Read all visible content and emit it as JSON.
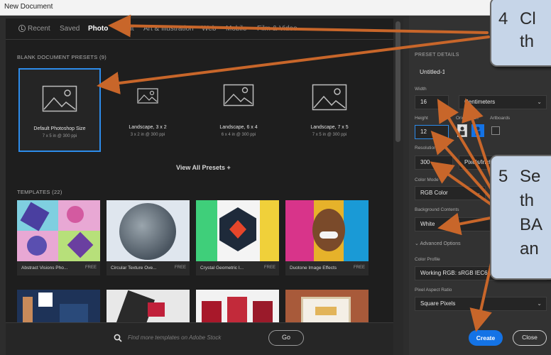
{
  "window": {
    "title": "New Document"
  },
  "tabs": [
    {
      "label": "Recent",
      "icon": "clock-icon"
    },
    {
      "label": "Saved"
    },
    {
      "label": "Photo",
      "active": true
    },
    {
      "label": "Print"
    },
    {
      "label": "Art & Illustration"
    },
    {
      "label": "Web"
    },
    {
      "label": "Mobile"
    },
    {
      "label": "Film & Video"
    }
  ],
  "presets": {
    "heading": "BLANK DOCUMENT PRESETS",
    "count": "(9)",
    "items": [
      {
        "name": "Default Photoshop Size",
        "desc": "7 x 5 in @ 300 ppi",
        "selected": true
      },
      {
        "name": "Landscape, 3 x 2",
        "desc": "3 x 2 in @ 300 ppi"
      },
      {
        "name": "Landscape, 6 x 4",
        "desc": "6 x 4 in @ 300 ppi"
      },
      {
        "name": "Landscape, 7 x 5",
        "desc": "7 x 5 in @ 300 ppi"
      }
    ],
    "view_all": "View All Presets +"
  },
  "templates": {
    "heading": "TEMPLATES",
    "count": "(22)",
    "items": [
      {
        "name": "Abstract Visions Pho...",
        "badge": "FREE"
      },
      {
        "name": "Circular Texture Ove...",
        "badge": "FREE"
      },
      {
        "name": "Crystal Geometric I...",
        "badge": "FREE"
      },
      {
        "name": "Duotone Image Effects",
        "badge": "FREE"
      }
    ]
  },
  "search": {
    "placeholder": "Find more templates on Adobe Stock",
    "go_label": "Go"
  },
  "details": {
    "heading": "PRESET DETAILS",
    "name": "Untitled-1",
    "width_label": "Width",
    "width_value": "16",
    "units": "Centimeters",
    "height_label": "Height",
    "height_value": "12",
    "orientation_label": "Orientation",
    "artboards_label": "Artboards",
    "resolution_label": "Resolution",
    "resolution_value": "300",
    "resolution_units": "Pixels/Inch",
    "color_mode_label": "Color Mode",
    "color_mode_value": "RGB Color",
    "background_label": "Background Contents",
    "background_value": "White",
    "advanced_label": "Advanced Options",
    "color_profile_label": "Color Profile",
    "color_profile_value": "Working RGB: sRGB IEC61966-2.1",
    "pixel_aspect_label": "Pixel Aspect Ratio",
    "pixel_aspect_value": "Square Pixels"
  },
  "buttons": {
    "create": "Create",
    "close": "Close"
  },
  "callouts": {
    "step4": {
      "number": "4",
      "lines": [
        "Cl",
        "th"
      ]
    },
    "step5": {
      "number": "5",
      "lines": [
        "Se",
        "th",
        "BA",
        "an"
      ]
    }
  },
  "colors": {
    "accent": "#1473e6",
    "annotation_arrow": "#c8662a",
    "callout_fill": "#c6d5e8"
  }
}
